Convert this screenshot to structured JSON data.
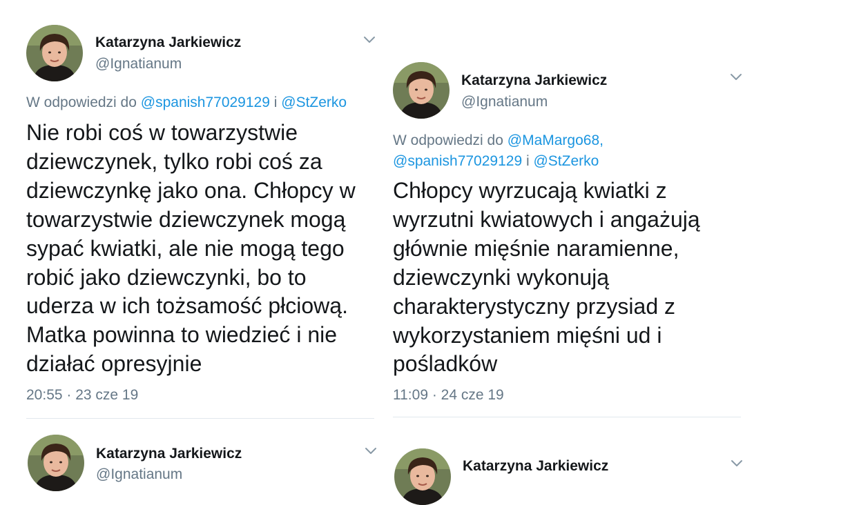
{
  "colors": {
    "link": "#1b95e0",
    "muted": "#657786",
    "text": "#14171a",
    "divider": "#e1e8ed"
  },
  "tweets": [
    {
      "name": "Katarzyna Jarkiewicz",
      "handle": "@Ignatianum",
      "reply_prefix": "W odpowiedzi do ",
      "mention1": "@spanish77029129",
      "conj": " i ",
      "mention2": "@StZerko",
      "text": "Nie robi coś w towarzystwie\ndziewczynek, tylko robi coś za\ndziewczynkę jako ona. Chłopcy w\ntowarzystwie dziewczynek mogą\nsypać kwiatki, ale nie mogą tego\nrobić jako dziewczynki, bo to\nuderza w ich tożsamość płciową.\nMatka powinna to wiedzieć i nie\ndziałać opresyjnie",
      "time": "20:55 · 23 cze 19",
      "menu_icon": "chevron-down-icon"
    },
    {
      "name": "Katarzyna Jarkiewicz",
      "handle": "@Ignatianum",
      "reply_prefix": "W odpowiedzi do ",
      "mention0": "@MaMargo68,",
      "mention1": "@spanish77029129",
      "conj": " i ",
      "mention2": "@StZerko",
      "text": "Chłopcy wyrzucają kwiatki z\nwyrzutni kwiatowych i angażują\ngłównie mięśnie naramienne,\ndziewczynki wykonują\ncharakterystyczny przysiad z\nwykorzystaniem mięśni ud i\npośladków",
      "time": "11:09 · 24 cze 19",
      "menu_icon": "chevron-down-icon"
    },
    {
      "name": "Katarzyna Jarkiewicz",
      "handle": "@Ignatianum",
      "menu_icon": "chevron-down-icon"
    },
    {
      "name": "Katarzyna Jarkiewicz",
      "menu_icon": "chevron-down-icon"
    }
  ]
}
